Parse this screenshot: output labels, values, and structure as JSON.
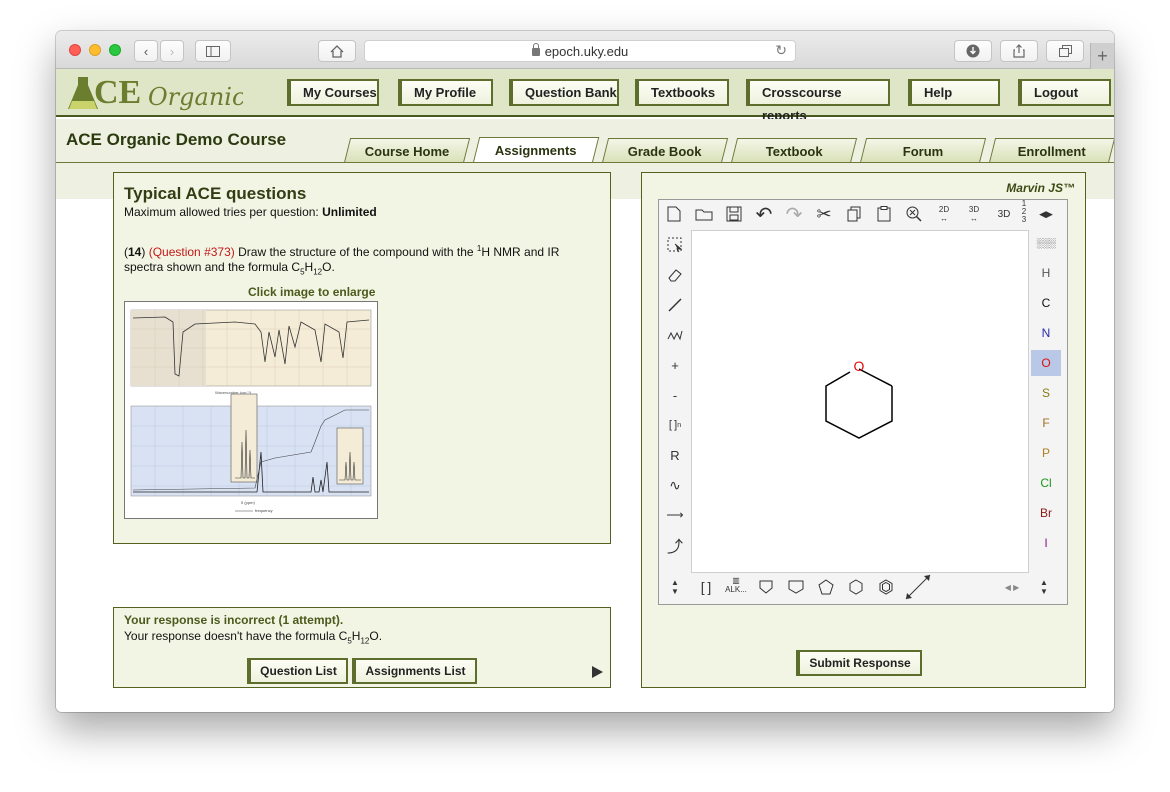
{
  "browser": {
    "url": "epoch.uky.edu"
  },
  "header": {
    "logo_text": "ACE Organic",
    "nav": [
      "My Courses",
      "My Profile",
      "Question Bank",
      "Textbooks",
      "Crosscourse reports",
      "Help",
      "Logout"
    ]
  },
  "course": {
    "title": "ACE Organic Demo Course",
    "tabs": [
      "Course Home",
      "Assignments",
      "Grade Book",
      "Textbook",
      "Forum",
      "Enrollment"
    ],
    "active_tab": "Assignments"
  },
  "question": {
    "heading": "Typical ACE questions",
    "tries_label": "Maximum allowed tries per question:",
    "tries_value": "Unlimited",
    "number": "14",
    "qid": "(Question #373)",
    "text_1": "Draw the structure of the compound with the",
    "sup": "1",
    "text_2": "H NMR and IR",
    "text_3": "spectra shown and the formula C",
    "sub1": "5",
    "h": "H",
    "sub2": "12",
    "o": "O.",
    "enlarge": "Click image to enlarge",
    "spectrum_axis_label": "δ (ppm)",
    "spectrum_freq_label": "frequency"
  },
  "response": {
    "status": "Your response is incorrect (1 attempt).",
    "detail_1": "Your response doesn't have the formula C",
    "sub1": "5",
    "h": "H",
    "sub2": "12",
    "o": "O.",
    "buttons": [
      "Question List",
      "Assignments List"
    ]
  },
  "marvin": {
    "title": "Marvin JS™",
    "submit": "Submit Response",
    "atom_label": "O",
    "elements": [
      "H",
      "C",
      "N",
      "O",
      "S",
      "F",
      "P",
      "Cl",
      "Br",
      "I"
    ],
    "element_colors": [
      "#555555",
      "#111111",
      "#2a2ab0",
      "#e01010",
      "#8a7a10",
      "#a07020",
      "#b08020",
      "#1a9a1a",
      "#8a1a1a",
      "#8a1a8a"
    ],
    "selected_element": "O",
    "top_labels": [
      "2D",
      "3D",
      "3D"
    ],
    "fraction_digits": [
      "1",
      "2",
      "3"
    ],
    "bottom_label": "ALK..."
  }
}
